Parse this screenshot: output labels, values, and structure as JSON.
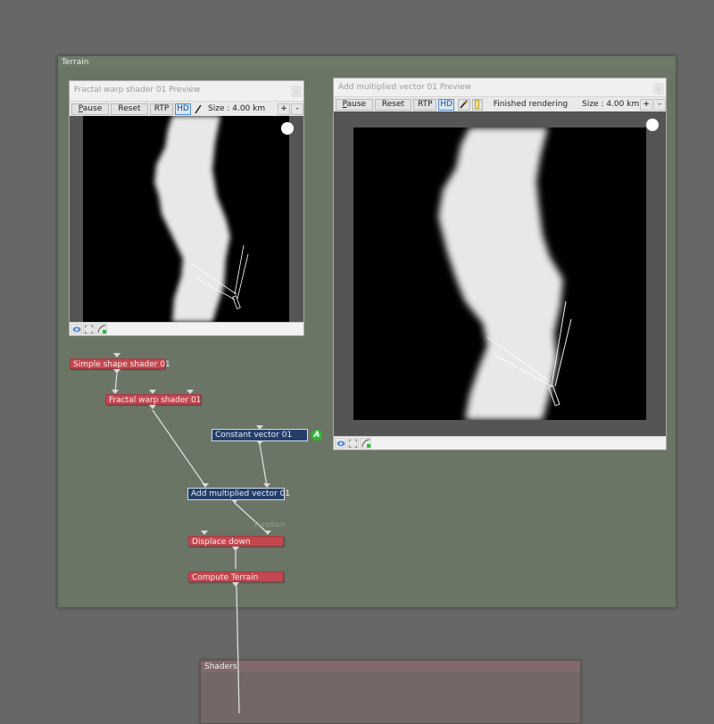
{
  "groups": {
    "terrain": {
      "title": "Terrain",
      "color": "#6b7566"
    },
    "shaders": {
      "title": "Shaders",
      "color": "#736767"
    }
  },
  "previews": [
    {
      "title": "Fractal warp shader 01 Preview",
      "close_label": "x",
      "toolbar": {
        "pause": "Pause",
        "reset": "Reset",
        "rtp": "RTP",
        "hd": "HD",
        "status": "",
        "size": "Size : 4.00 km",
        "zoom_in": "+",
        "zoom_out": "-"
      }
    },
    {
      "title": "Add multiplied vector 01 Preview",
      "close_label": "x",
      "toolbar": {
        "pause": "Pause",
        "reset": "Reset",
        "rtp": "RTP",
        "hd": "HD",
        "status": "Finished rendering",
        "size": "Size : 4.00 km",
        "zoom_in": "+",
        "zoom_out": "-"
      }
    }
  ],
  "nodes": {
    "simple_shape": {
      "label": "Simple shape shader 01",
      "type": "shader"
    },
    "fractal_warp": {
      "label": "Fractal warp shader 01",
      "type": "shader"
    },
    "constant_vector": {
      "label": "Constant vector 01",
      "type": "function",
      "badge": "A"
    },
    "add_multiplied": {
      "label": "Add multiplied vector 01",
      "type": "function"
    },
    "displace_down": {
      "label": "Displace down",
      "type": "shader"
    },
    "compute_terrain": {
      "label": "Compute Terrain",
      "type": "shader"
    }
  },
  "edge_labels": {
    "function": "Function"
  },
  "colors": {
    "shader_node": "#c4474f",
    "function_node": "#243f6a",
    "badge": "#27c02b",
    "background": "#676767"
  }
}
